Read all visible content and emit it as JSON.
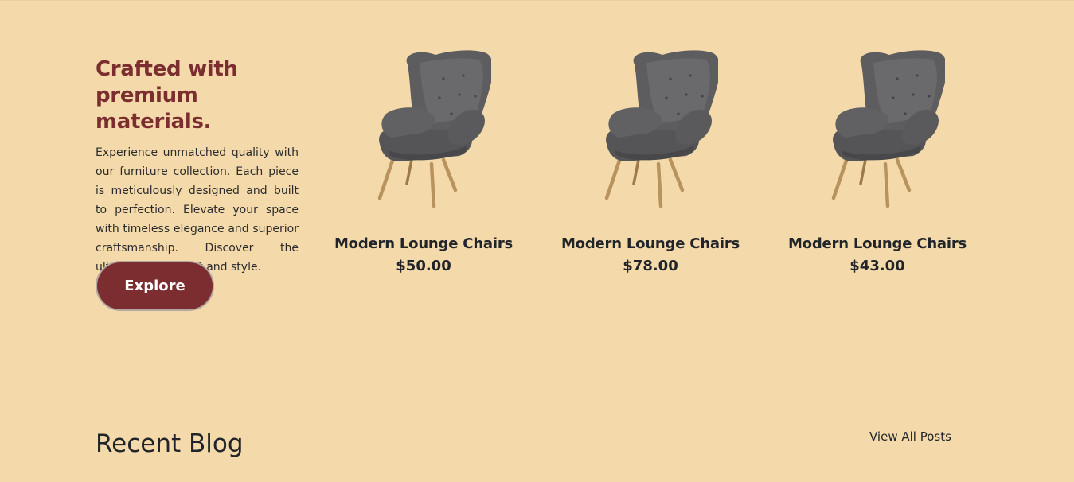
{
  "hero": {
    "heading_line1": "Crafted with",
    "heading_line2": "premium materials.",
    "body": "Experience unmatched quality with our furniture collection. Each piece is meticulously designed and built to perfection. Elevate your space with timeless elegance and superior craftsmanship. Discover the ultimate in comfort and style.",
    "button_label": "Explore"
  },
  "products": [
    {
      "name": "Modern Lounge Chairs",
      "price": "$50.00",
      "icon": "armchair-image"
    },
    {
      "name": "Modern Lounge Chairs",
      "price": "$78.00",
      "icon": "armchair-image"
    },
    {
      "name": "Modern Lounge Chairs",
      "price": "$43.00",
      "icon": "armchair-image"
    }
  ],
  "blog": {
    "title": "Recent Blog",
    "view_all_label": "View All Posts"
  },
  "colors": {
    "background": "#f4daab",
    "accent": "#7b2d2f",
    "text": "#212529"
  }
}
